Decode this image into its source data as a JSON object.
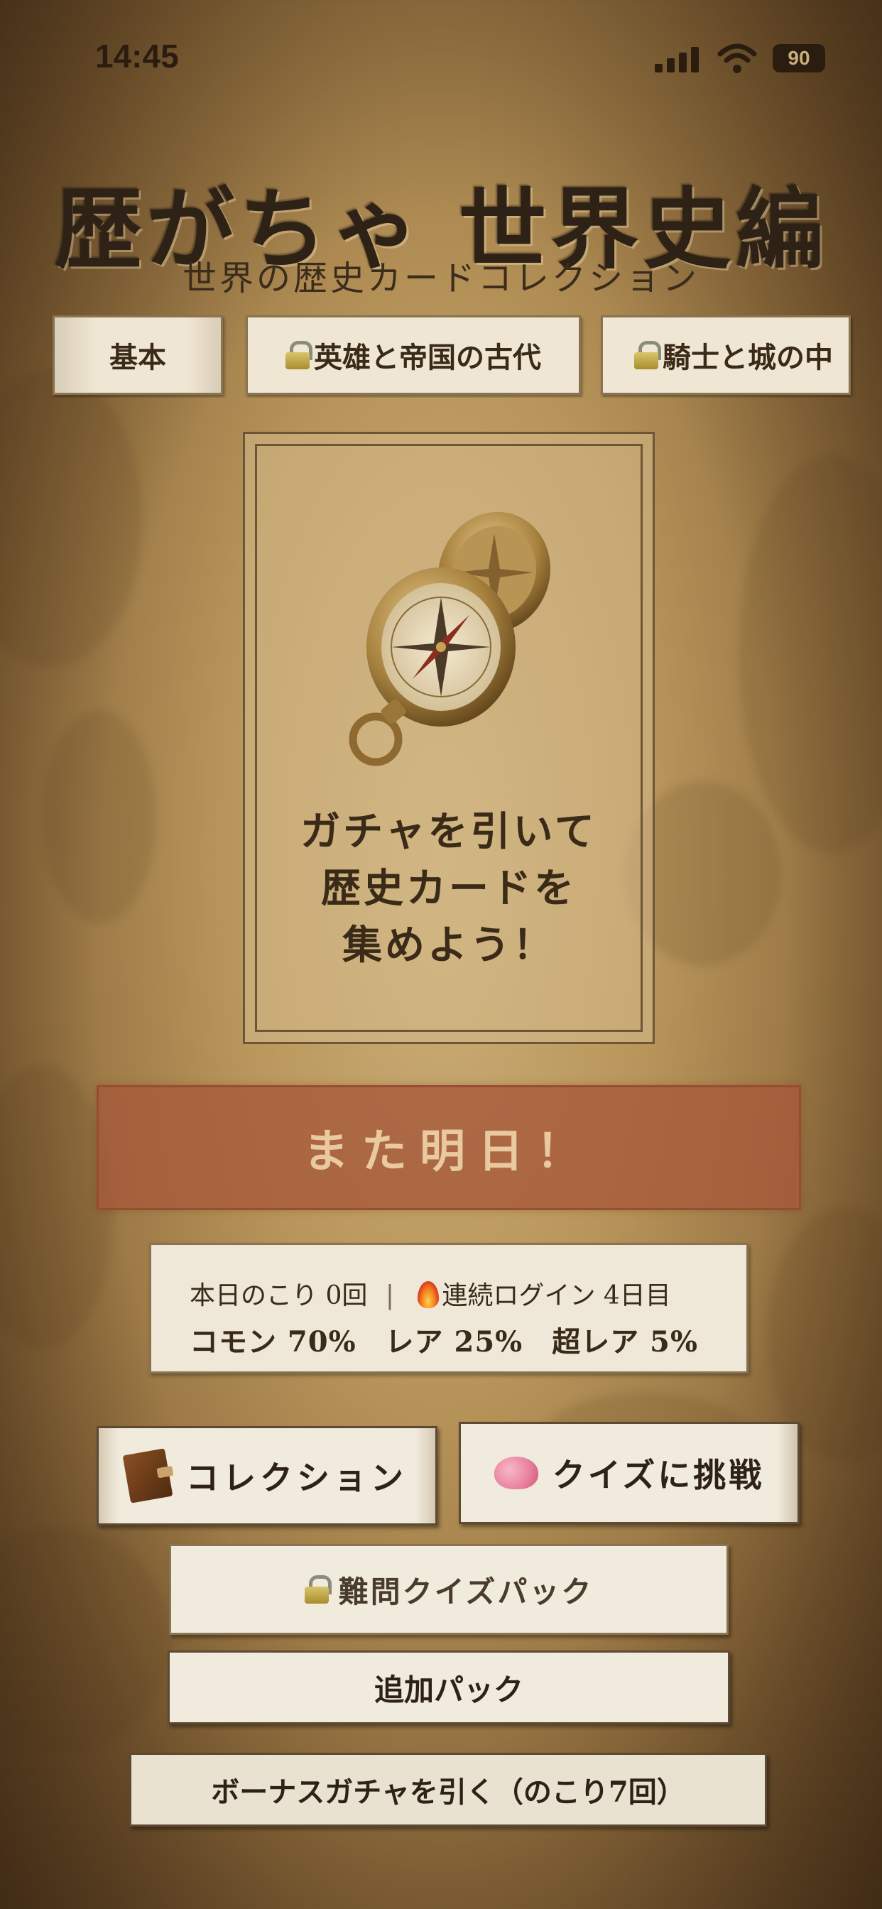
{
  "status_bar": {
    "time": "14:45",
    "battery": "90"
  },
  "header": {
    "title": "歴がちゃ 世界史編",
    "subtitle": "世界の歴史カードコレクション"
  },
  "tabs": [
    {
      "label": "基本",
      "locked": false,
      "active": true
    },
    {
      "label": "英雄と帝国の古代",
      "locked": true,
      "active": false
    },
    {
      "label": "騎士と城の中",
      "locked": true,
      "active": false
    }
  ],
  "card": {
    "illustration": "compass-icon",
    "lines": [
      "ガチャを引いて",
      "歴史カードを",
      "集めよう！"
    ]
  },
  "main_button": {
    "label": "また明日！",
    "color": "#a6583a"
  },
  "info": {
    "remaining": "本日のこり 0回",
    "separator": "|",
    "streak": "連続ログイン 4日目",
    "rates": "コモン 70%　レア 25%　超レア 5%"
  },
  "actions": {
    "collection": "コレクション",
    "quiz": "クイズに挑戦",
    "hard_quiz": "難問クイズパック",
    "extra_pack": "追加パック",
    "bonus": "ボーナスガチャを引く（のこり7回）"
  },
  "colors": {
    "parchment": "#c9ad7a",
    "ink": "#3a2a18",
    "accent": "#a6583a"
  }
}
